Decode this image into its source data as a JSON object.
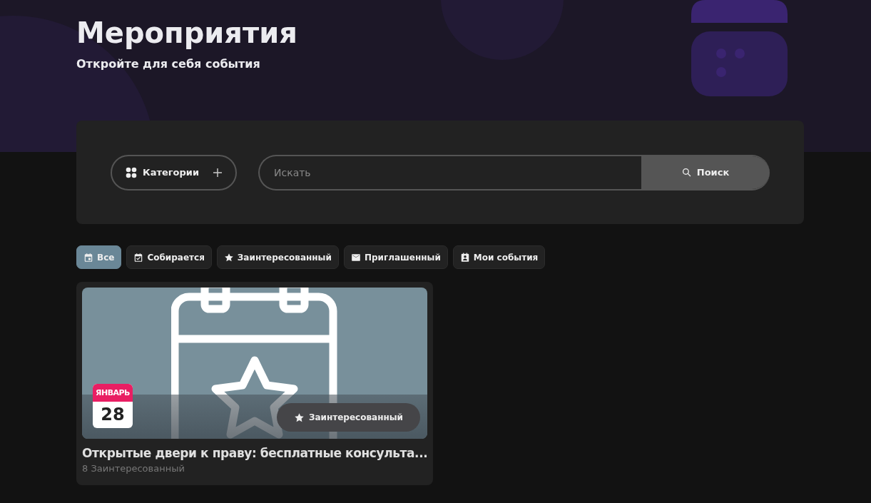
{
  "header": {
    "title": "Мероприятия",
    "subtitle": "Откройте для себя события"
  },
  "search_panel": {
    "categories_button": {
      "label": "Категории"
    },
    "search": {
      "placeholder": "Искать"
    },
    "search_button": {
      "label": "Поиск"
    }
  },
  "filters": [
    {
      "kind": "calendar",
      "label": "Все",
      "selected": true
    },
    {
      "kind": "check",
      "label": "Собирается",
      "selected": false
    },
    {
      "kind": "star",
      "label": "Заинтересованный",
      "selected": false
    },
    {
      "kind": "mail",
      "label": "Приглашенный",
      "selected": false
    },
    {
      "kind": "person",
      "label": "Мои события",
      "selected": false
    }
  ],
  "events": [
    {
      "month": "ЯНВАРЬ",
      "day": "28",
      "interest_button": {
        "label": "Заинтересованный"
      },
      "title": "Открытые двери к праву: бесплатные консульта...",
      "interested_count": "8 Заинтересованный"
    }
  ]
}
